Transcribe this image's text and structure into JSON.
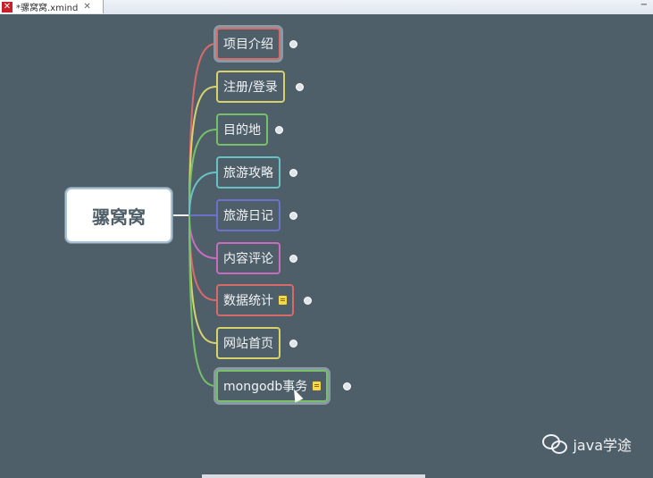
{
  "tab": {
    "title": "*骡窝窝.xmind",
    "close": "✕",
    "minimize": "−"
  },
  "mindmap": {
    "central": "骡窝窝",
    "topics": [
      {
        "label": "项目介绍",
        "color": "#d86a6a",
        "note": false,
        "selected": true
      },
      {
        "label": "注册/登录",
        "color": "#d7d26b",
        "note": false,
        "selected": false
      },
      {
        "label": "目的地",
        "color": "#76c06a",
        "note": false,
        "selected": false
      },
      {
        "label": "旅游攻略",
        "color": "#69c1c6",
        "note": false,
        "selected": false
      },
      {
        "label": "旅游日记",
        "color": "#6c72c9",
        "note": false,
        "selected": false
      },
      {
        "label": "内容评论",
        "color": "#c86cc0",
        "note": false,
        "selected": false
      },
      {
        "label": "数据统计",
        "color": "#d86a6a",
        "note": true,
        "selected": false
      },
      {
        "label": "网站首页",
        "color": "#d7d26b",
        "note": false,
        "selected": false
      },
      {
        "label": "mongodb事务",
        "color": "#76c06a",
        "note": true,
        "selected": true
      }
    ]
  },
  "watermark": {
    "text": "java学途"
  }
}
